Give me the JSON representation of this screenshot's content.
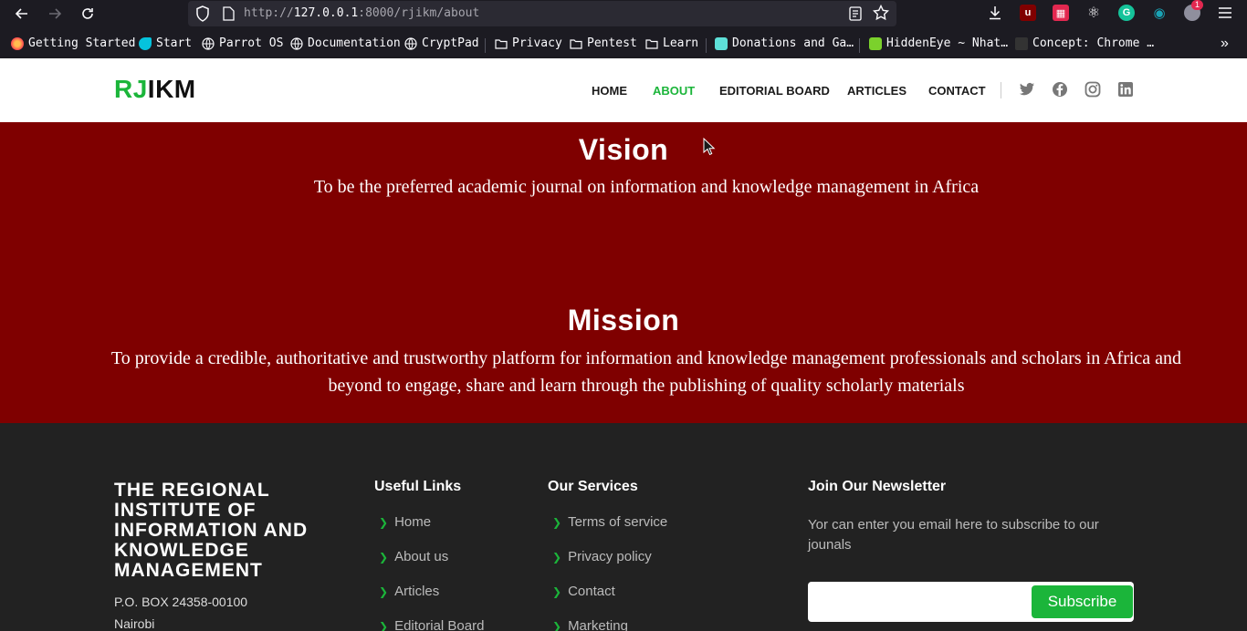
{
  "browser": {
    "url_protocol": "http://",
    "url_host": "127.0.0.1",
    "url_path": ":8000/rjikm/about",
    "extension_badge": "1",
    "bookmarks": [
      {
        "label": "Getting Started",
        "icon": "firefox-icon"
      },
      {
        "label": "Start",
        "icon": "parrot-icon"
      },
      {
        "label": "Parrot OS",
        "icon": "globe-icon"
      },
      {
        "label": "Documentation",
        "icon": "globe-icon"
      },
      {
        "label": "CryptPad",
        "icon": "globe-icon"
      },
      {
        "label": "Privacy",
        "icon": "folder-icon"
      },
      {
        "label": "Pentest",
        "icon": "folder-icon"
      },
      {
        "label": "Learn",
        "icon": "folder-icon"
      },
      {
        "label": "Donations and Ga…",
        "icon": "site-icon"
      },
      {
        "label": "HiddenEye ~ Nhat…",
        "icon": "site-icon"
      },
      {
        "label": "Concept: Chrome …",
        "icon": "site-icon"
      }
    ]
  },
  "site": {
    "logo_a": "RJ",
    "logo_b": "IKM",
    "nav": {
      "home": "HOME",
      "about": "ABOUT",
      "editorial": "EDITORIAL BOARD",
      "articles": "ARTICLES",
      "contact": "CONTACT"
    },
    "brand_green": "#1bb53a",
    "band_color": "#7f0000"
  },
  "vision": {
    "title": "Vision",
    "text": "To be the preferred academic journal on information and knowledge management in Africa"
  },
  "mission": {
    "title": "Mission",
    "line1": "To provide a credible, authoritative and trustworthy platform for information and knowledge management professionals and scholars in Africa and",
    "line2": "beyond to engage, share and learn through the publishing of quality scholarly materials"
  },
  "footer": {
    "org_name": "THE REGIONAL INSTITUTE OF INFORMATION AND KNOWLEDGE MANAGEMENT",
    "address1": "P.O. BOX 24358-00100",
    "address2": "Nairobi",
    "useful_heading": "Useful Links",
    "useful_links": [
      "Home",
      "About us",
      "Articles",
      "Editorial Board"
    ],
    "services_heading": "Our Services",
    "services_links": [
      "Terms of service",
      "Privacy policy",
      "Contact",
      "Marketing"
    ],
    "newsletter_heading": "Join Our Newsletter",
    "newsletter_text": "Yor can enter you email here to subscribe to our jounals",
    "newsletter_input_value": "",
    "subscribe_label": "Subscribe"
  }
}
